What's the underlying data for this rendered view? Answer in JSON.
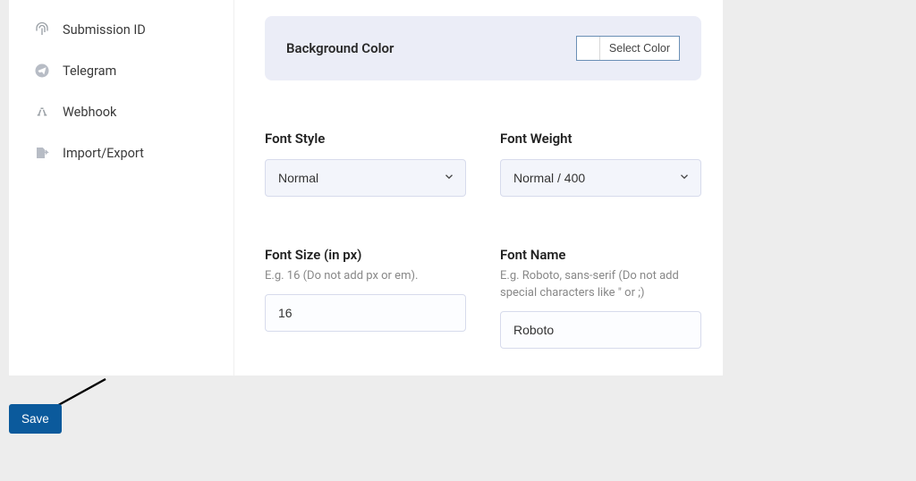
{
  "sidebar": {
    "items": [
      {
        "label": "Submission ID"
      },
      {
        "label": "Telegram"
      },
      {
        "label": "Webhook"
      },
      {
        "label": "Import/Export"
      }
    ]
  },
  "panel": {
    "title": "Background Color",
    "select_color_label": "Select Color"
  },
  "fields": {
    "font_style": {
      "label": "Font Style",
      "value": "Normal"
    },
    "font_weight": {
      "label": "Font Weight",
      "value": "Normal / 400"
    },
    "font_size": {
      "label": "Font Size (in px)",
      "help": "E.g. 16 (Do not add px or em).",
      "value": "16"
    },
    "font_name": {
      "label": "Font Name",
      "help": "E.g. Roboto, sans-serif (Do not add special characters like \" or ;)",
      "value": "Roboto"
    }
  },
  "save_label": "Save"
}
